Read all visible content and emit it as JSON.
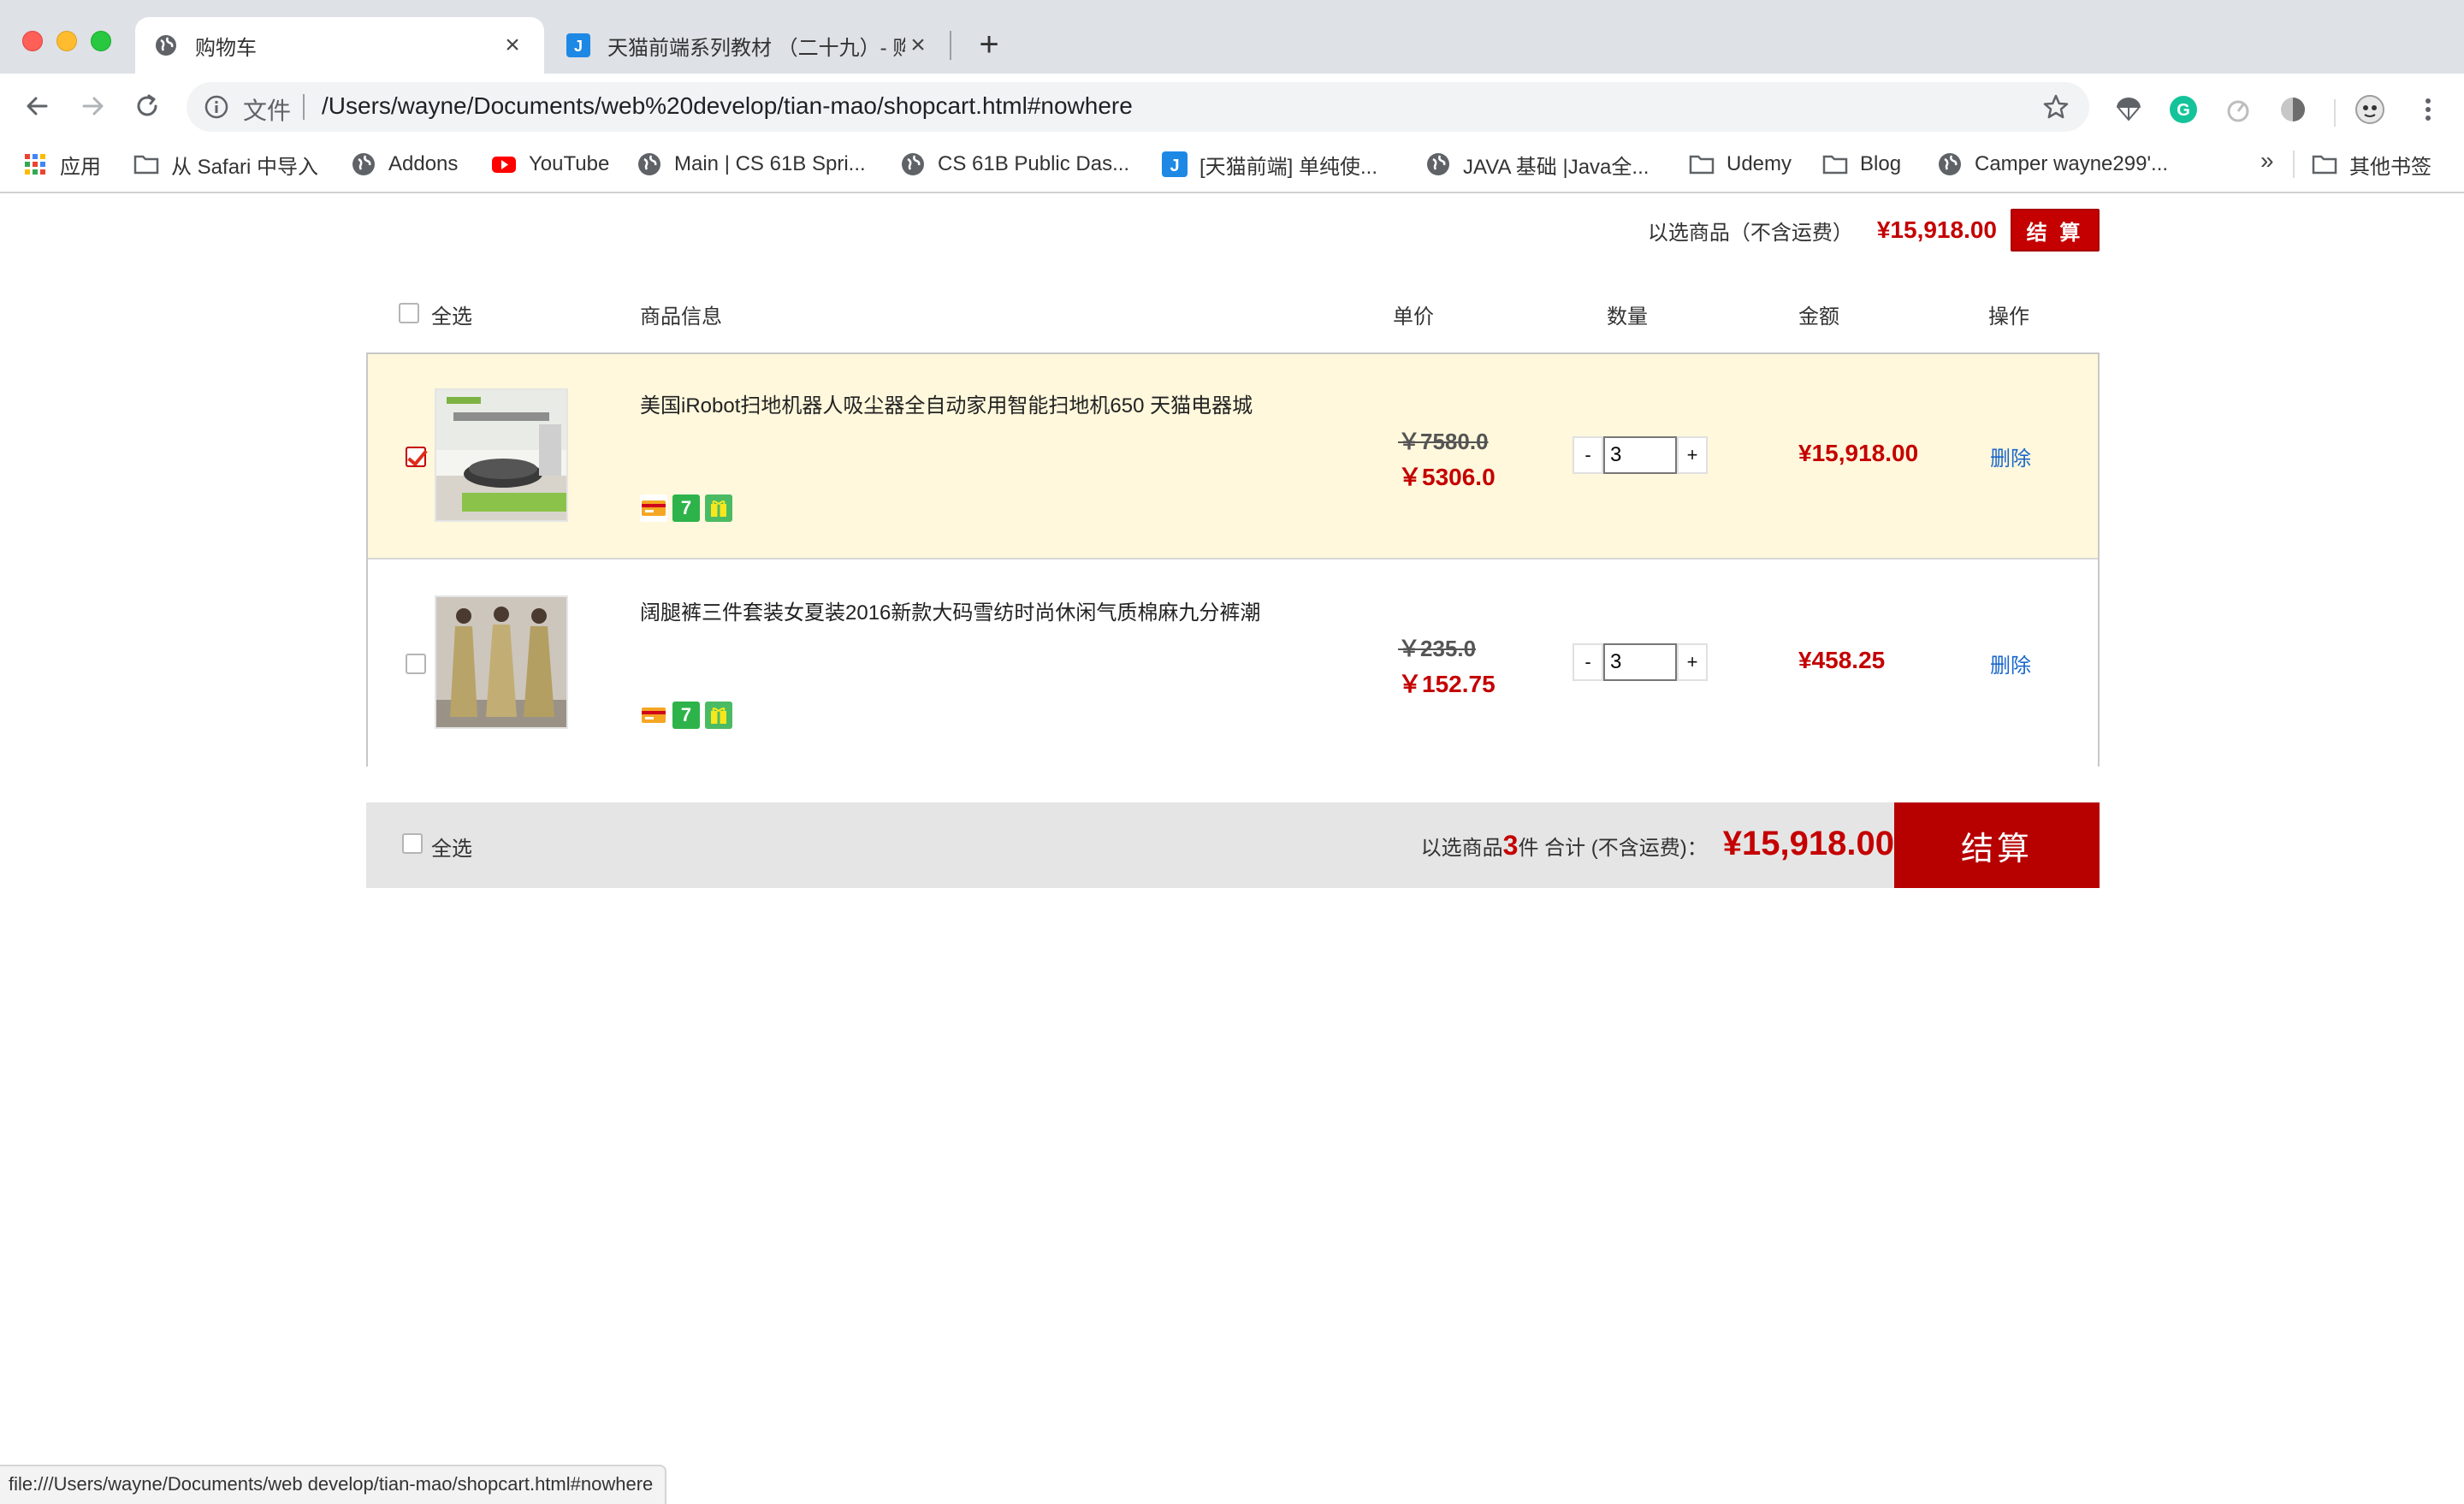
{
  "browser": {
    "tabs": [
      {
        "title": "购物车",
        "active": true
      },
      {
        "title": "天猫前端系列教材 （二十九）- 购",
        "active": false
      }
    ],
    "omnibox": {
      "scheme_label": "文件",
      "url": "/Users/wayne/Documents/web%20develop/tian-mao/shopcart.html#nowhere"
    },
    "bookmarks": [
      {
        "label": "应用",
        "icon": "apps-grid-icon"
      },
      {
        "label": "从 Safari 中导入",
        "icon": "folder-icon"
      },
      {
        "label": "Addons",
        "icon": "globe-icon"
      },
      {
        "label": "YouTube",
        "icon": "youtube-icon"
      },
      {
        "label": "Main | CS 61B Spri...",
        "icon": "globe-icon"
      },
      {
        "label": "CS 61B Public Das...",
        "icon": "globe-icon"
      },
      {
        "label": "[天猫前端] 单纯使...",
        "icon": "j-logo-icon"
      },
      {
        "label": "JAVA 基础 |Java全...",
        "icon": "globe-icon"
      },
      {
        "label": "Udemy",
        "icon": "folder-icon"
      },
      {
        "label": "Blog",
        "icon": "folder-icon"
      },
      {
        "label": "Camper wayne299'...",
        "icon": "globe-icon"
      },
      {
        "label": "其他书签",
        "icon": "folder-icon"
      }
    ],
    "more_label": "»",
    "status_url": "file:///Users/wayne/Documents/web develop/tian-mao/shopcart.html#nowhere"
  },
  "cart": {
    "top_summary": {
      "label": "以选商品（不含运费）",
      "amount": "¥15,918.00",
      "button": "结 算"
    },
    "header": {
      "select_all": "全选",
      "info": "商品信息",
      "unit_price": "单价",
      "quantity": "数量",
      "amount": "金额",
      "action": "操作"
    },
    "items": [
      {
        "name": "美国iRobot扫地机器人吸尘器全自动家用智能扫地机650 天猫电器城",
        "old_price": "￥7580.0",
        "price": "￥5306.0",
        "qty": "3",
        "subtotal": "¥15,918.00",
        "delete": "删除",
        "checked": true
      },
      {
        "name": "阔腿裤三件套装女夏装2016新款大码雪纺时尚休闲气质棉麻九分裤潮",
        "old_price": "￥235.0",
        "price": "￥152.75",
        "qty": "3",
        "subtotal": "¥458.25",
        "delete": "删除",
        "checked": false
      }
    ],
    "stepper": {
      "minus": "-",
      "plus": "+"
    },
    "badges": {
      "seven": "7"
    },
    "bottom": {
      "select_all": "全选",
      "prefix": "以选商品",
      "count": "3",
      "suffix": "件 合计 (不含运费)：",
      "total": "¥15,918.00",
      "checkout": "结算"
    }
  },
  "colors": {
    "accent": "#c40000",
    "link": "#1a66cc",
    "row_highlight": "#fff8dc",
    "bottom_bar": "#e5e5e5"
  }
}
